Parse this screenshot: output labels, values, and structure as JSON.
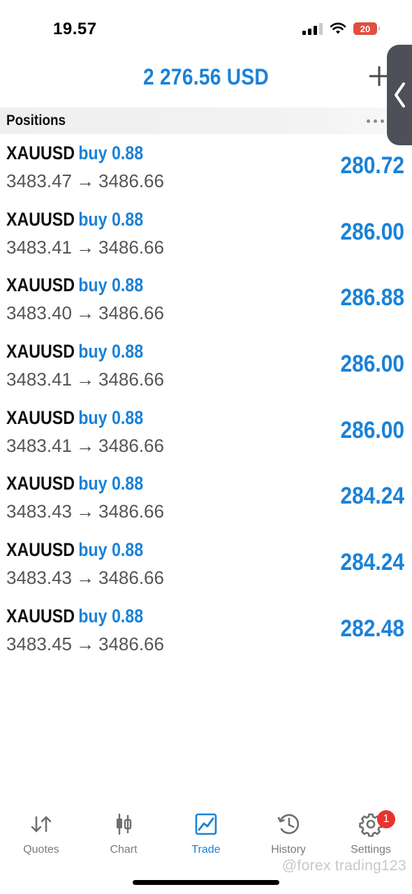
{
  "status_bar": {
    "time": "19.57",
    "battery": "20"
  },
  "header": {
    "balance": "2 276.56 USD"
  },
  "positions_section": {
    "title": "Positions"
  },
  "positions": [
    {
      "symbol": "XAUUSD",
      "side": "buy 0.88",
      "open_price": "3483.47",
      "arrow": "→",
      "current_price": "3486.66",
      "profit": "280.72"
    },
    {
      "symbol": "XAUUSD",
      "side": "buy 0.88",
      "open_price": "3483.41",
      "arrow": "→",
      "current_price": "3486.66",
      "profit": "286.00"
    },
    {
      "symbol": "XAUUSD",
      "side": "buy 0.88",
      "open_price": "3483.40",
      "arrow": "→",
      "current_price": "3486.66",
      "profit": "286.88"
    },
    {
      "symbol": "XAUUSD",
      "side": "buy 0.88",
      "open_price": "3483.41",
      "arrow": "→",
      "current_price": "3486.66",
      "profit": "286.00"
    },
    {
      "symbol": "XAUUSD",
      "side": "buy 0.88",
      "open_price": "3483.41",
      "arrow": "→",
      "current_price": "3486.66",
      "profit": "286.00"
    },
    {
      "symbol": "XAUUSD",
      "side": "buy 0.88",
      "open_price": "3483.43",
      "arrow": "→",
      "current_price": "3486.66",
      "profit": "284.24"
    },
    {
      "symbol": "XAUUSD",
      "side": "buy 0.88",
      "open_price": "3483.43",
      "arrow": "→",
      "current_price": "3486.66",
      "profit": "284.24"
    },
    {
      "symbol": "XAUUSD",
      "side": "buy 0.88",
      "open_price": "3483.45",
      "arrow": "→",
      "current_price": "3486.66",
      "profit": "282.48"
    }
  ],
  "tabs": [
    {
      "label": "Quotes",
      "icon": "quotes-arrows-icon"
    },
    {
      "label": "Chart",
      "icon": "candlestick-chart-icon"
    },
    {
      "label": "Trade",
      "icon": "trade-line-chart-icon",
      "active": true
    },
    {
      "label": "History",
      "icon": "history-clock-icon"
    },
    {
      "label": "Settings",
      "icon": "gear-icon",
      "badge": "1"
    }
  ],
  "watermark": "@forex trading123",
  "colors": {
    "accent": "#1a82d8",
    "badge": "#e8332f",
    "battery_low": "#e04e3f"
  }
}
